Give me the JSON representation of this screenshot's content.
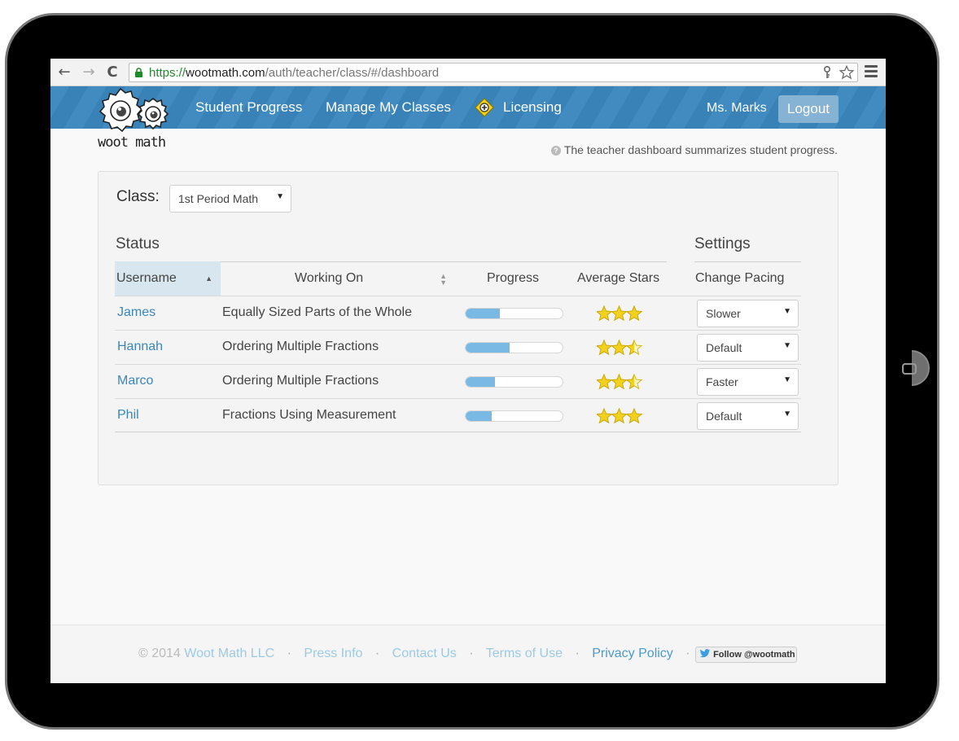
{
  "browser": {
    "back_glyph": "←",
    "forward_glyph": "→",
    "reload_glyph": "C",
    "url_scheme": "https://",
    "url_host": "wootmath.com",
    "url_path": "/auth/teacher/class/#/dashboard",
    "icons": [
      "back-arrow-icon",
      "forward-arrow-icon",
      "reload-icon",
      "lock-icon",
      "key-icon",
      "star-icon",
      "menu-icon"
    ]
  },
  "header": {
    "logo_text": "woot math",
    "nav": [
      {
        "label": "Student Progress"
      },
      {
        "label": "Manage My Classes"
      },
      {
        "label": "Licensing"
      }
    ],
    "user_name": "Ms. Marks",
    "logout_label": "Logout",
    "colors": {
      "header_bg": "#3a86bd",
      "licensing_icon": "#f4d10f"
    }
  },
  "help_text": "The teacher dashboard summarizes student progress.",
  "dashboard": {
    "class_label": "Class:",
    "class_selected": "1st Period Math",
    "status_title": "Status",
    "settings_title": "Settings",
    "columns": {
      "username": "Username",
      "working_on": "Working On",
      "progress": "Progress",
      "average_stars": "Average Stars",
      "change_pacing": "Change Pacing"
    },
    "rows": [
      {
        "username": "James",
        "working_on": "Equally Sized Parts of the Whole",
        "progress": 0.35,
        "stars": 3,
        "pacing": "Slower"
      },
      {
        "username": "Hannah",
        "working_on": "Ordering Multiple Fractions",
        "progress": 0.45,
        "stars": 2.5,
        "pacing": "Default"
      },
      {
        "username": "Marco",
        "working_on": "Ordering Multiple Fractions",
        "progress": 0.3,
        "stars": 2.5,
        "pacing": "Faster"
      },
      {
        "username": "Phil",
        "working_on": "Fractions Using Measurement",
        "progress": 0.27,
        "stars": 3,
        "pacing": "Default"
      }
    ],
    "colors": {
      "link": "#3a86bd",
      "progress_fill": "#7ab9e3",
      "star": "#f2d21f"
    }
  },
  "footer": {
    "copyright": "© 2014",
    "company": "Woot Math LLC",
    "press": "Press Info",
    "contact": "Contact Us",
    "terms": "Terms of Use",
    "privacy": "Privacy Policy",
    "separator": "·",
    "follow_label": "Follow @wootmath"
  }
}
